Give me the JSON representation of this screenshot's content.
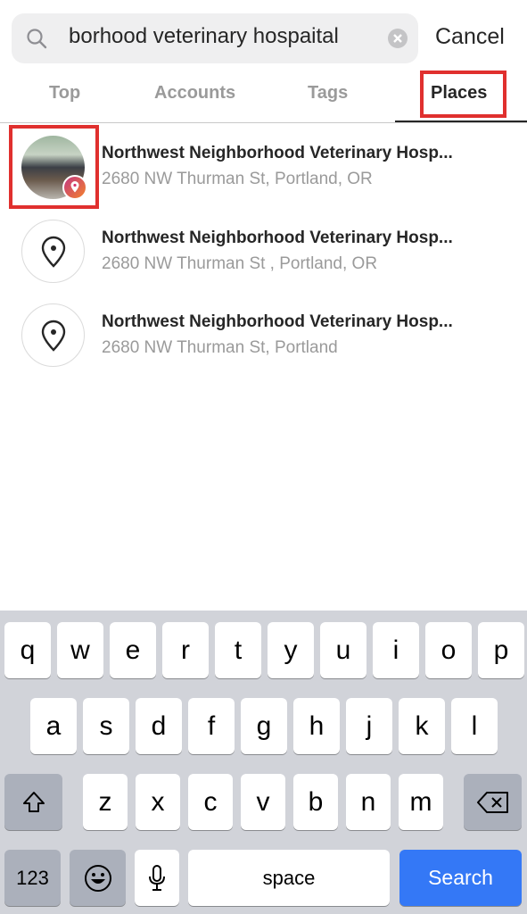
{
  "search": {
    "query": "borhood veterinary hospaital",
    "cancel_label": "Cancel"
  },
  "tabs": [
    {
      "label": "Top"
    },
    {
      "label": "Accounts"
    },
    {
      "label": "Tags"
    },
    {
      "label": "Places",
      "selected": true
    }
  ],
  "results": [
    {
      "title": "Northwest Neighborhood Veterinary Hosp...",
      "address": "2680 NW Thurman St, Portland, OR",
      "icon": "photo-with-location-badge"
    },
    {
      "title": "Northwest Neighborhood Veterinary Hosp...",
      "address": "2680 NW Thurman St , Portland, OR",
      "icon": "location-pin-icon"
    },
    {
      "title": "Northwest Neighborhood Veterinary Hosp...",
      "address": "2680 NW Thurman St, Portland",
      "icon": "location-pin-icon"
    }
  ],
  "keyboard": {
    "row1": [
      "q",
      "w",
      "e",
      "r",
      "t",
      "y",
      "u",
      "i",
      "o",
      "p"
    ],
    "row2": [
      "a",
      "s",
      "d",
      "f",
      "g",
      "h",
      "j",
      "k",
      "l"
    ],
    "row3": [
      "z",
      "x",
      "c",
      "v",
      "b",
      "n",
      "m"
    ],
    "numbers_label": "123",
    "space_label": "space",
    "search_label": "Search"
  },
  "colors": {
    "highlight": "#e0302e",
    "search_key": "#3478f6"
  }
}
